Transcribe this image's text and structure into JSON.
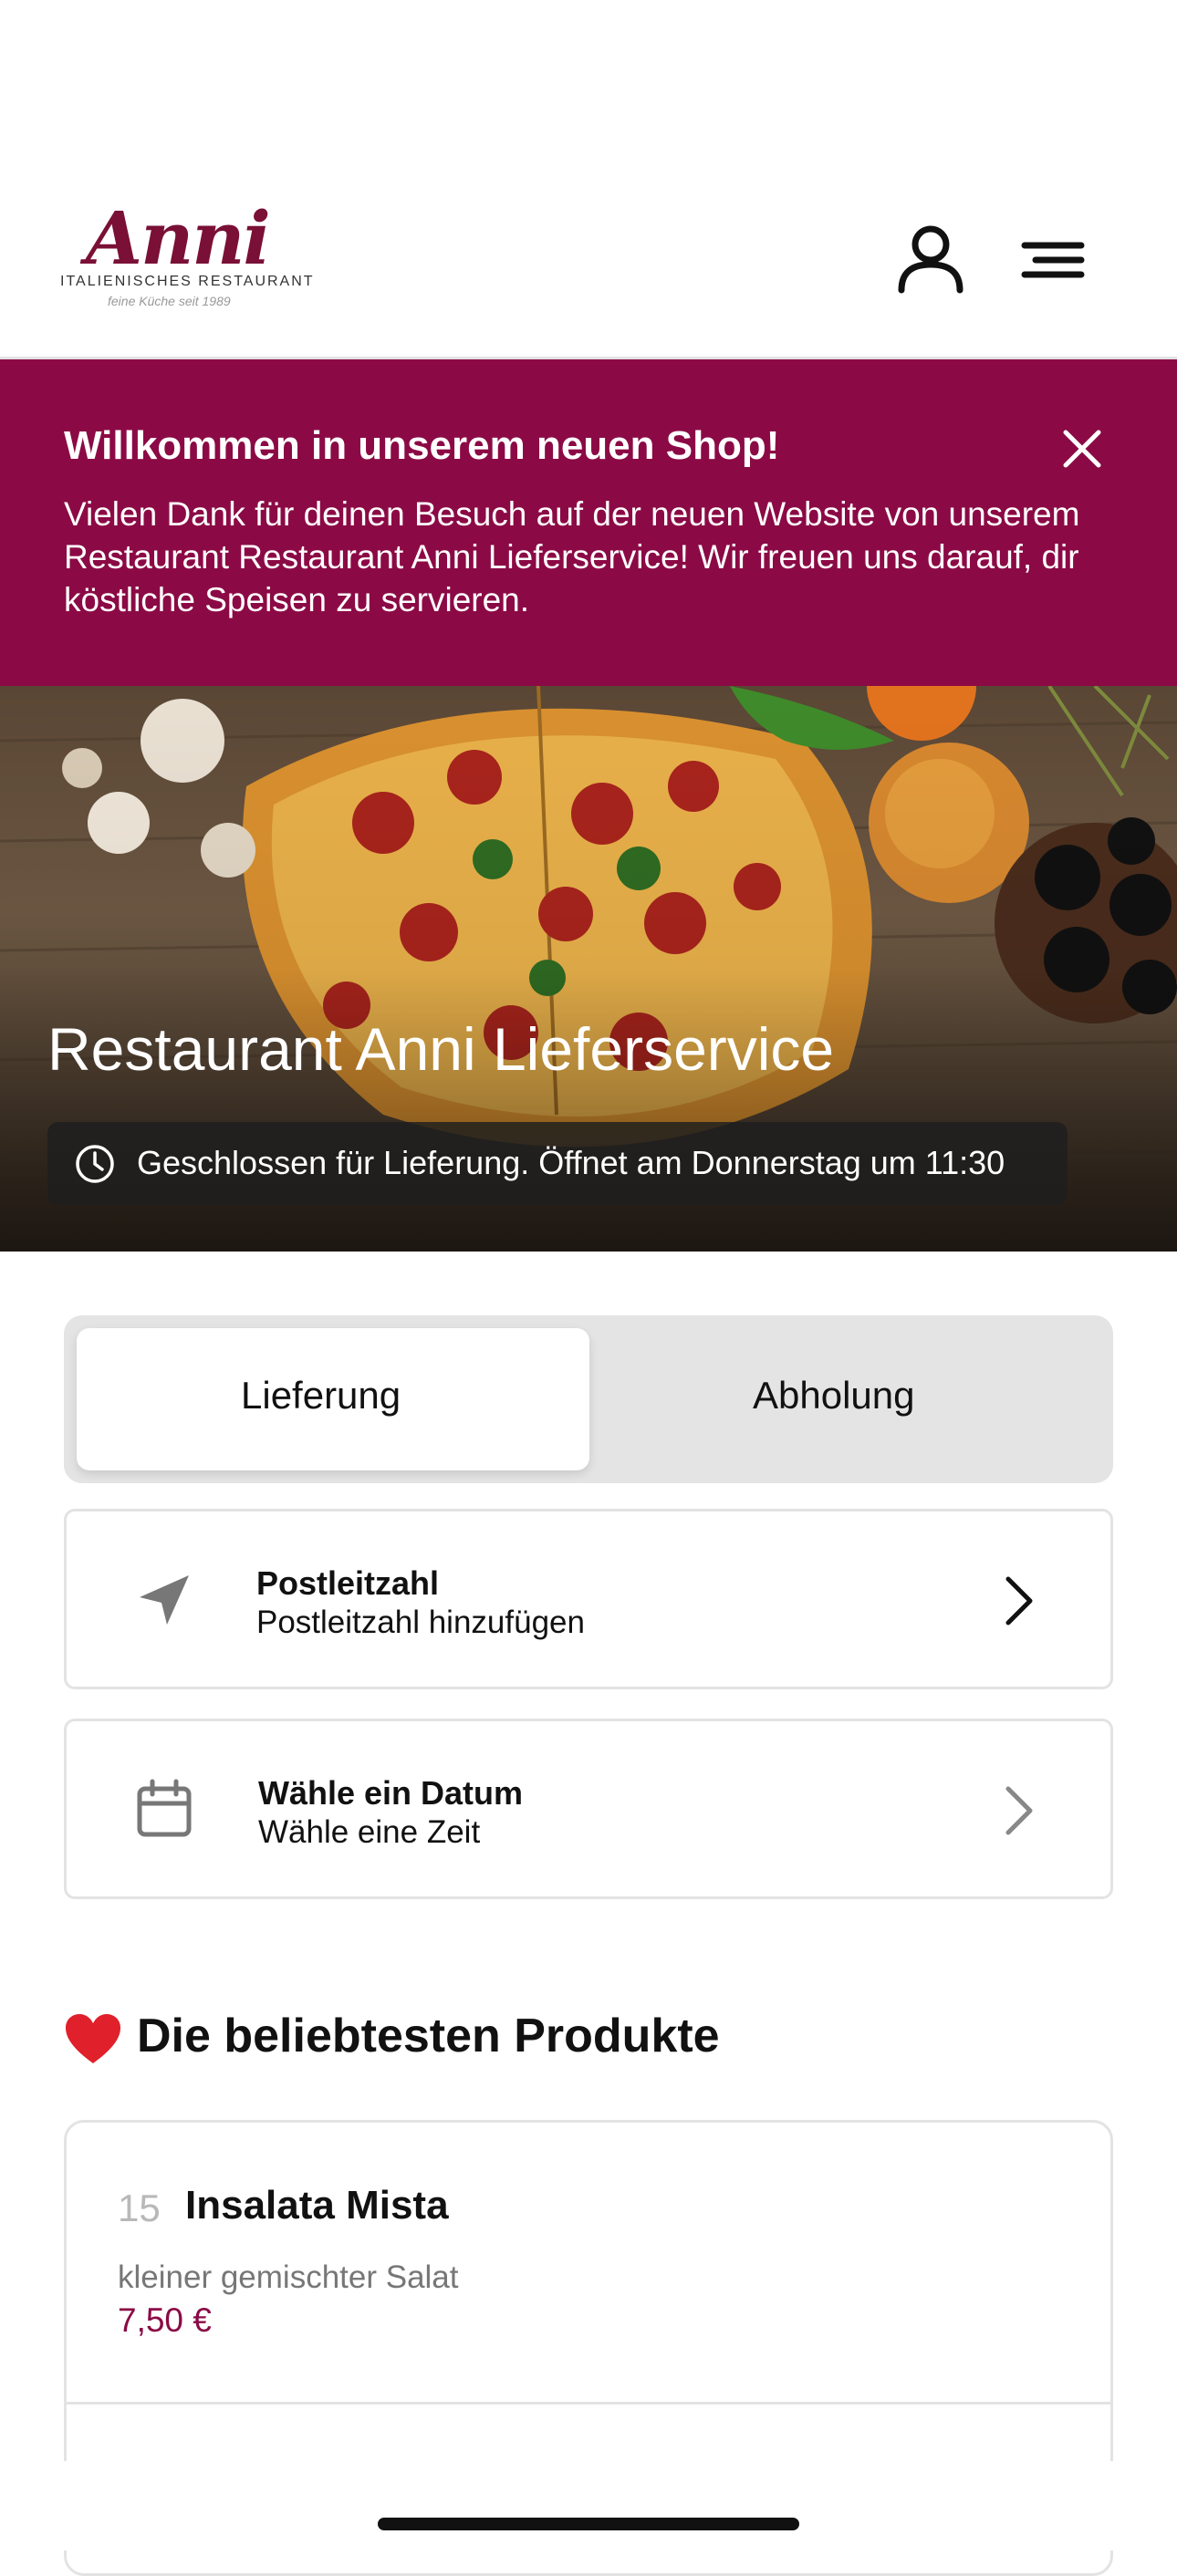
{
  "header": {
    "logo": {
      "name": "Anni",
      "subtitle": "ITALIENISCHES RESTAURANT",
      "tagline": "feine Küche seit 1989"
    },
    "account_icon": "user-icon",
    "menu_icon": "hamburger-menu-icon"
  },
  "banner": {
    "title": "Willkommen in unserem neuen Shop!",
    "text": "Vielen Dank für deinen Besuch auf der neuen Website von unserem Restaurant Restaurant Anni Lieferservice! Wir freuen uns darauf, dir köstliche Speisen zu servieren.",
    "close_icon": "close-icon",
    "color": "#8b0a45"
  },
  "hero": {
    "title": "Restaurant Anni Lieferservice",
    "status": "Geschlossen für Lieferung. Öffnet am Donnerstag um 11:30",
    "status_icon": "clock-icon"
  },
  "order_mode": {
    "options": [
      "Lieferung",
      "Abholung"
    ],
    "selected": "Lieferung"
  },
  "postcode_card": {
    "label": "Postleitzahl",
    "value": "Postleitzahl hinzufügen",
    "icon": "location-arrow-icon"
  },
  "date_card": {
    "label": "Wähle ein Datum",
    "value": "Wähle eine Zeit",
    "icon": "calendar-icon"
  },
  "popular": {
    "title": "Die beliebtesten Produkte",
    "icon": "heart-icon",
    "products": [
      {
        "number": "15",
        "name": "Insalata Mista",
        "description": "kleiner gemischter Salat",
        "price": "7,50 €"
      }
    ]
  }
}
